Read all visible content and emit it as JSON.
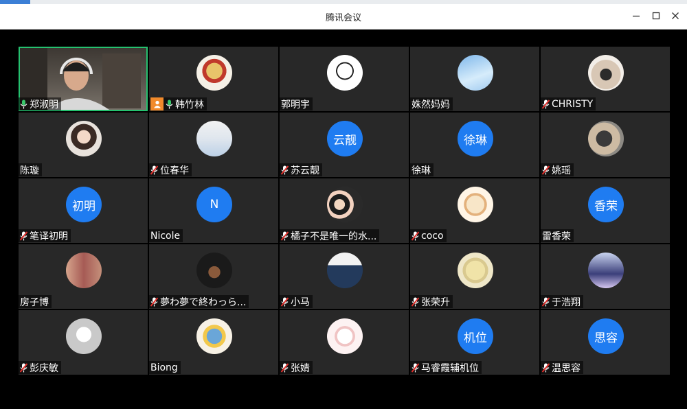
{
  "window": {
    "title": "腾讯会议",
    "minimize_icon": "minimize-icon",
    "maximize_icon": "maximize-icon",
    "close_icon": "close-icon"
  },
  "colors": {
    "avatar_blue": "#1f7cf1",
    "tile_bg": "#282828",
    "speaking_border": "#25c16f",
    "mic_on": "#3ac76b",
    "mic_muted": "#e0302c",
    "host_badge": "#f18a2b"
  },
  "participants": [
    {
      "name": "郑淑明",
      "mic": "on",
      "video": true,
      "speaking": true
    },
    {
      "name": "韩竹林",
      "mic": "on",
      "host": true,
      "avatar_type": "photo",
      "avatar_icon": "cartoon-monkey-avatar"
    },
    {
      "name": "郭明宇",
      "mic": "none",
      "avatar_type": "photo",
      "avatar_icon": "meme-face-avatar"
    },
    {
      "name": "姝然妈妈",
      "mic": "none",
      "avatar_type": "photo",
      "avatar_icon": "sky-clouds-avatar"
    },
    {
      "name": "CHRISTY",
      "mic": "muted",
      "avatar_type": "photo",
      "avatar_icon": "person-photo-avatar"
    },
    {
      "name": "陈璇",
      "mic": "none",
      "avatar_type": "photo",
      "avatar_icon": "girl-photo-avatar"
    },
    {
      "name": "位春华",
      "mic": "muted",
      "avatar_type": "photo",
      "avatar_icon": "dress-photo-avatar"
    },
    {
      "name": "苏云靓",
      "mic": "muted",
      "avatar_type": "text",
      "avatar_text": "云靓"
    },
    {
      "name": "徐琳",
      "mic": "none",
      "avatar_type": "text",
      "avatar_text": "徐琳"
    },
    {
      "name": "姚瑶",
      "mic": "muted",
      "avatar_type": "photo",
      "avatar_icon": "person-photo-avatar"
    },
    {
      "name": "笔译初明",
      "mic": "muted",
      "avatar_type": "text",
      "avatar_text": "初明"
    },
    {
      "name": "Nicole",
      "mic": "none",
      "avatar_type": "text",
      "avatar_text": "N"
    },
    {
      "name": "橘子不是唯一的水...",
      "mic": "muted",
      "avatar_type": "photo",
      "avatar_icon": "two-girls-photo-avatar"
    },
    {
      "name": "coco",
      "mic": "muted",
      "avatar_type": "photo",
      "avatar_icon": "cartoon-cat-avatar"
    },
    {
      "name": "雷香荣",
      "mic": "none",
      "avatar_type": "text",
      "avatar_text": "香荣"
    },
    {
      "name": "房子博",
      "mic": "none",
      "avatar_type": "photo",
      "avatar_icon": "two-men-photo-avatar"
    },
    {
      "name": "夢わ夢で終わっら...",
      "mic": "muted",
      "avatar_type": "photo",
      "avatar_icon": "dark-art-avatar"
    },
    {
      "name": "小马",
      "mic": "muted",
      "avatar_type": "photo",
      "avatar_icon": "dad-shirt-avatar"
    },
    {
      "name": "张荣升",
      "mic": "muted",
      "avatar_type": "photo",
      "avatar_icon": "cartoon-rabbit-avatar"
    },
    {
      "name": "于浩翔",
      "mic": "muted",
      "avatar_type": "photo",
      "avatar_icon": "basketball-player-avatar"
    },
    {
      "name": "彭庆敏",
      "mic": "muted",
      "avatar_type": "photo",
      "avatar_icon": "default-person-avatar"
    },
    {
      "name": "Biong",
      "mic": "none",
      "avatar_type": "photo",
      "avatar_icon": "cartoon-face-avatar"
    },
    {
      "name": "张婧",
      "mic": "muted",
      "avatar_type": "photo",
      "avatar_icon": "drawn-girl-avatar"
    },
    {
      "name": "马睿霞辅机位",
      "mic": "muted",
      "avatar_type": "text",
      "avatar_text": "机位"
    },
    {
      "name": "温思容",
      "mic": "muted",
      "avatar_type": "text",
      "avatar_text": "思容"
    }
  ]
}
